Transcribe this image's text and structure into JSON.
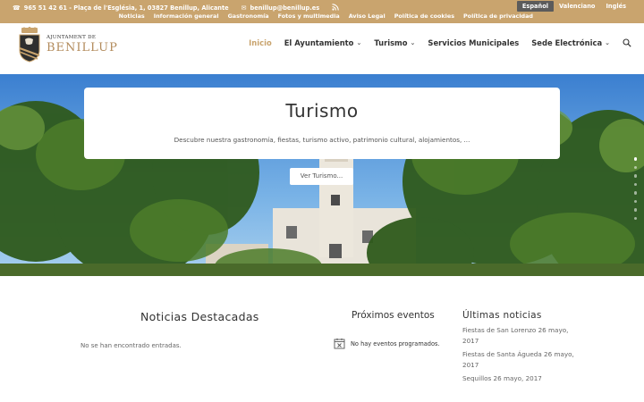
{
  "topbar": {
    "phone": "965 51 42 61 - Plaça de l'Església, 1, 03827 Benillup, Alicante",
    "email": "benillup@benillup.es",
    "links": [
      "Noticias",
      "Información general",
      "Gastronomía",
      "Fotos y multimedia",
      "Aviso Legal",
      "Política de cookies",
      "Política de privacidad"
    ],
    "languages": [
      "Español",
      "Valenciano",
      "Inglés"
    ],
    "active_language": "Español"
  },
  "header": {
    "logo_small": "AJUNTAMENT DE",
    "logo_big": "BENILLUP",
    "nav": [
      {
        "label": "Inicio",
        "active": true,
        "dropdown": false
      },
      {
        "label": "El Ayuntamiento",
        "active": false,
        "dropdown": true
      },
      {
        "label": "Turismo",
        "active": false,
        "dropdown": true
      },
      {
        "label": "Servicios Municipales",
        "active": false,
        "dropdown": false
      },
      {
        "label": "Sede Electrónica",
        "active": false,
        "dropdown": true
      }
    ]
  },
  "hero": {
    "title": "Turismo",
    "subtitle": "Descubre nuestra gastronomía, fiestas, turismo activo, patrimonio cultural, alojamientos, ...",
    "button": "Ver Turismo...",
    "slide_count": 8,
    "active_slide": 1
  },
  "news": {
    "title": "Noticias Destacadas",
    "empty": "No se han encontrado entradas."
  },
  "events": {
    "title": "Próximos eventos",
    "empty": "No hay eventos programados."
  },
  "latest": {
    "title": "Últimas noticias",
    "items": [
      "Fiestas de San Lorenzo 26 mayo, 2017",
      "Fiestas de Santa Águeda 26 mayo, 2017",
      "Sequillos 26 mayo, 2017"
    ]
  },
  "colors": {
    "accent": "#c9a46e",
    "lang_active_bg": "#5b5b5b"
  }
}
